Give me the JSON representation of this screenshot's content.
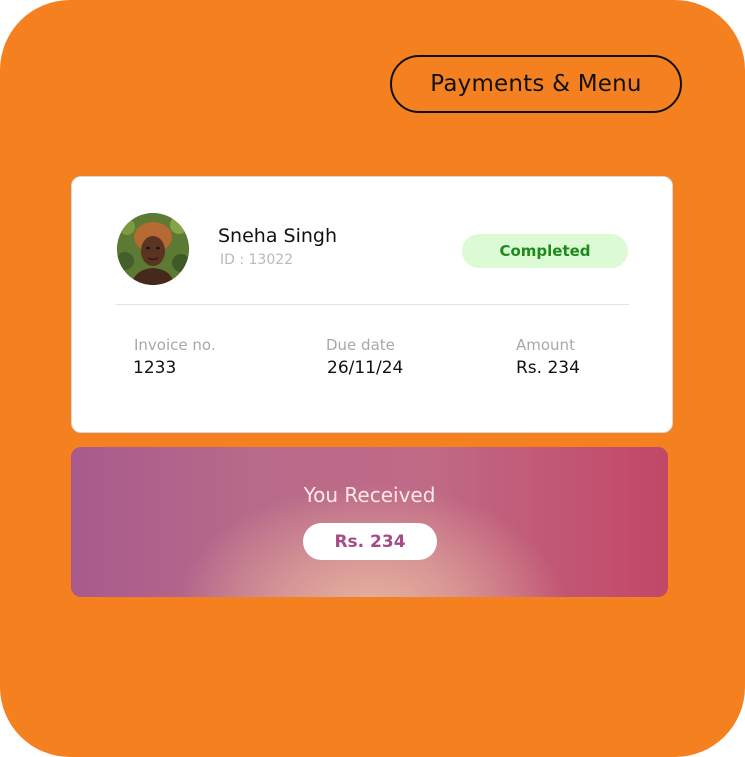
{
  "header": {
    "nav_label": "Payments & Menu"
  },
  "card": {
    "user": {
      "name": "Sneha Singh",
      "id_text": "ID : 13022"
    },
    "status": "Completed",
    "fields": {
      "invoice_label": "Invoice no.",
      "invoice_value": "1233",
      "due_label": "Due date",
      "due_value": "26/11/24",
      "amount_label": "Amount",
      "amount_value": "Rs. 234"
    }
  },
  "received": {
    "title": "You Received",
    "amount": "Rs. 234"
  },
  "colors": {
    "background": "#f58020",
    "status_bg": "#dcfad4",
    "status_text": "#1e8a1e",
    "amount_text": "#a74b86"
  }
}
